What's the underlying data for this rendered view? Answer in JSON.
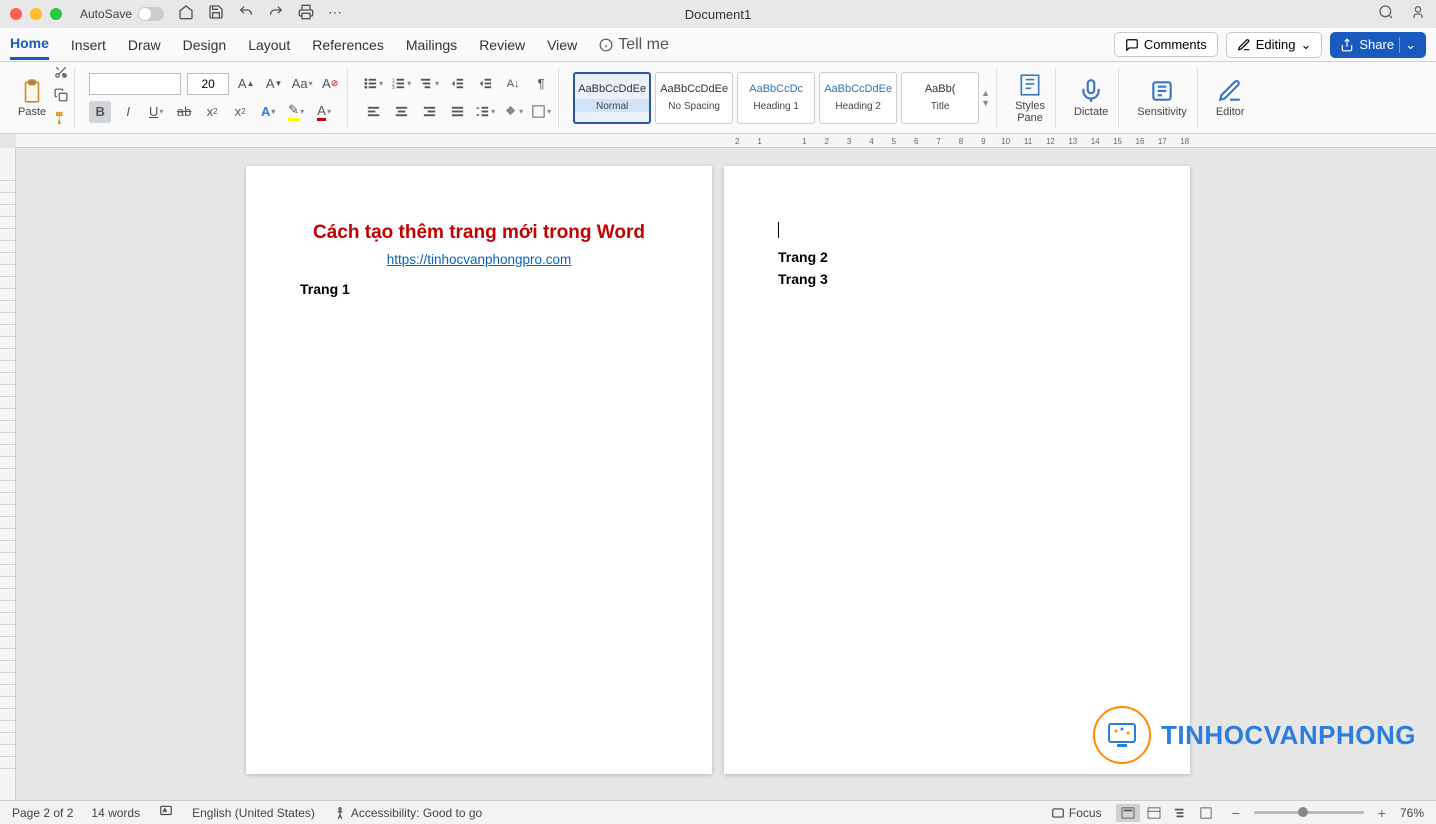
{
  "titlebar": {
    "autosave": "AutoSave",
    "doc_title": "Document1"
  },
  "tabs": [
    "Home",
    "Insert",
    "Draw",
    "Design",
    "Layout",
    "References",
    "Mailings",
    "Review",
    "View"
  ],
  "tell_me": "Tell me",
  "top_buttons": {
    "comments": "Comments",
    "editing": "Editing",
    "share": "Share"
  },
  "ribbon": {
    "paste": "Paste",
    "font_name": "",
    "font_size": "20",
    "styles": [
      {
        "preview": "AaBbCcDdEe",
        "label": "Normal",
        "blue": false,
        "sel": true
      },
      {
        "preview": "AaBbCcDdEe",
        "label": "No Spacing",
        "blue": false,
        "sel": false
      },
      {
        "preview": "AaBbCcDc",
        "label": "Heading 1",
        "blue": true,
        "sel": false
      },
      {
        "preview": "AaBbCcDdEe",
        "label": "Heading 2",
        "blue": true,
        "sel": false
      },
      {
        "preview": "AaBb(",
        "label": "Title",
        "blue": false,
        "sel": false
      }
    ],
    "styles_pane": "Styles\nPane",
    "dictate": "Dictate",
    "sensitivity": "Sensitivity",
    "editor": "Editor"
  },
  "ruler_nums": [
    "2",
    "1",
    "",
    "1",
    "2",
    "3",
    "4",
    "5",
    "6",
    "7",
    "8",
    "9",
    "10",
    "11",
    "12",
    "13",
    "14",
    "15",
    "16",
    "17",
    "18"
  ],
  "document": {
    "page1": {
      "title": "Cách tạo thêm trang mới trong Word",
      "link": "https://tinhocvanphongpro.com",
      "line1": "Trang 1"
    },
    "page2": {
      "line1": "Trang 2",
      "line2": "Trang 3"
    }
  },
  "watermark": "TINHOCVANPHONG",
  "status": {
    "page": "Page 2 of 2",
    "words": "14 words",
    "lang": "English (United States)",
    "acc": "Accessibility: Good to go",
    "focus": "Focus",
    "zoom": "76%"
  }
}
